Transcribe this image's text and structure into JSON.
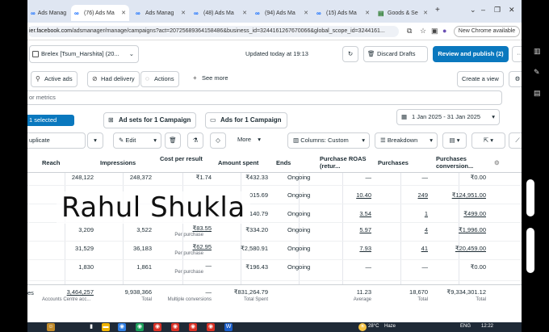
{
  "browser": {
    "tabs": [
      {
        "label": "Ads Manag",
        "icon": "meta-icon",
        "active": false
      },
      {
        "label": "(76) Ads Ma",
        "icon": "meta-icon",
        "active": true
      },
      {
        "label": "Ads Manag",
        "icon": "meta-icon",
        "active": false
      },
      {
        "label": "(48) Ads Ma",
        "icon": "meta-icon",
        "active": false
      },
      {
        "label": "(94) Ads Ma",
        "icon": "meta-icon",
        "active": false
      },
      {
        "label": "(15) Ads Ma",
        "icon": "meta-icon",
        "active": false
      },
      {
        "label": "Goods & Se",
        "icon": "doc-icon",
        "active": false
      }
    ],
    "new_tab": "+",
    "window_controls": [
      "⌄",
      "–",
      "❐",
      "✕"
    ],
    "url_prefix": "ier.facebook.com",
    "url_rest": "/adsmanager/manage/campaigns?act=20725689364158486&business_id=3244161267670066&global_scope_id=3244161...",
    "chrome_update": "New Chrome available"
  },
  "topbar": {
    "account": "Brelex [Tsum_Harshita] (20...",
    "updated": "Updated today at 19:13",
    "discard": "Discard Drafts",
    "review": "Review and publish (2)",
    "more": "···"
  },
  "filters": {
    "active_ads": "Active ads",
    "had_delivery": "Had delivery",
    "actions": "Actions",
    "see_more": "See more",
    "create_view": "Create a view"
  },
  "search": {
    "text": "or metrics"
  },
  "levels": {
    "selected": "1 selected",
    "adsets": "Ad sets for 1 Campaign",
    "ads": "Ads for 1 Campaign",
    "date_range": "1 Jan 2025 - 31 Jan 2025"
  },
  "actions": {
    "duplicate": "uplicate",
    "edit": "Edit",
    "more": "More",
    "columns": "Columns: Custom",
    "breakdown": "Breakdown"
  },
  "table": {
    "headers": [
      "Reach",
      "Impressions",
      "Cost per result",
      "Amount spent",
      "Ends",
      "Purchase ROAS (retur...",
      "Purchases",
      "Purchases conversion..."
    ],
    "rows": [
      {
        "reach": "248,122",
        "impr": "248,372",
        "cpr": "₹1.74",
        "cpr_sub": "",
        "spent": "₹432.33",
        "ends": "Ongoing",
        "roas": "—",
        "purch": "—",
        "conv": "₹0.00"
      },
      {
        "reach": "",
        "impr": "",
        "cpr": "",
        "cpr_sub": "",
        "spent": "015.69",
        "ends": "Ongoing",
        "roas": "10.40",
        "purch": "249",
        "conv": "₹124,951.00"
      },
      {
        "reach": "",
        "impr": "",
        "cpr": "",
        "cpr_sub": "",
        "spent": "140.79",
        "ends": "Ongoing",
        "roas": "3.54",
        "purch": "1",
        "conv": "₹499.00"
      },
      {
        "reach": "3,209",
        "impr": "3,522",
        "cpr": "₹83.55",
        "cpr_sub": "Per purchase",
        "spent": "₹334.20",
        "ends": "Ongoing",
        "roas": "5.97",
        "purch": "4",
        "conv": "₹1,996.00"
      },
      {
        "reach": "31,529",
        "impr": "36,183",
        "cpr": "₹62.95",
        "cpr_sub": "Per purchase",
        "spent": "₹2,580.91",
        "ends": "Ongoing",
        "roas": "7.93",
        "purch": "41",
        "conv": "₹20,459.00"
      },
      {
        "reach": "1,830",
        "impr": "1,861",
        "cpr": "—",
        "cpr_sub": "Per purchase",
        "spent": "₹196.43",
        "ends": "Ongoing",
        "roas": "—",
        "purch": "—",
        "conv": "₹0.00"
      }
    ],
    "totals": {
      "label": "es",
      "reach": "3,464,257",
      "reach_sub": "Accounts Centre acc...",
      "impr": "9,938,366",
      "impr_sub": "Total",
      "cpr": "—",
      "cpr_sub": "Multiple conversions",
      "spent": "₹831,264.79",
      "spent_sub": "Total Spent",
      "roas": "11.23",
      "roas_sub": "Average",
      "purch": "18,670",
      "purch_sub": "Total",
      "conv": "₹9,334,301.12",
      "conv_sub": "Total"
    }
  },
  "overlay": {
    "name": "Rahul Shukla"
  },
  "taskbar": {
    "weather": "28°C",
    "weather_label": "Haze",
    "lang": "ENG",
    "time": "12:22"
  }
}
